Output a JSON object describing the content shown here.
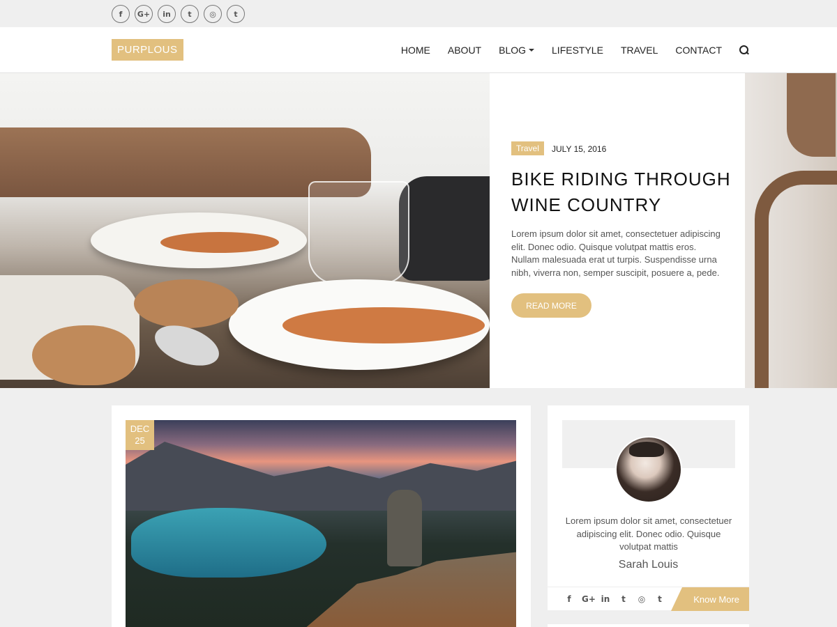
{
  "top_social": [
    "f",
    "G+",
    "in",
    "t",
    "◎",
    "t"
  ],
  "site": {
    "logo": "PURPLOUS"
  },
  "nav": {
    "items": [
      "HOME",
      "ABOUT",
      "BLOG",
      "LIFESTYLE",
      "TRAVEL",
      "CONTACT"
    ]
  },
  "hero": {
    "category": "Travel",
    "date": "JULY 15, 2016",
    "title": "BIKE RIDING THROUGH WINE COUNTRY",
    "excerpt": "Lorem ipsum dolor sit amet, consectetuer adipiscing elit. Donec odio. Quisque volutpat mattis eros. Nullam malesuada erat ut turpis. Suspendisse urna nibh, viverra non, semper suscipit, posuere a, pede.",
    "button": "READ MORE"
  },
  "post": {
    "date_month": "DEC",
    "date_day": "25"
  },
  "author": {
    "bio": "Lorem ipsum dolor sit amet, consectetuer adipiscing elit. Donec odio. Quisque volutpat mattis",
    "name": "Sarah Louis",
    "social": [
      "f",
      "G+",
      "in",
      "t",
      "◎",
      "t"
    ],
    "button": "Know More"
  },
  "colors": {
    "accent": "#e2c07f",
    "background": "#efefef"
  }
}
